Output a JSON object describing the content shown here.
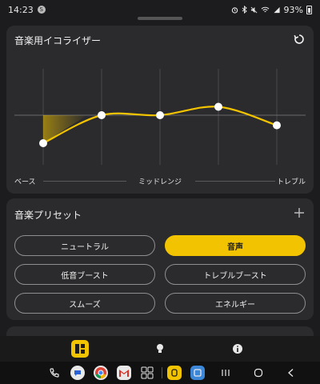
{
  "status_bar": {
    "time": "14:23",
    "notification_badge": "S",
    "battery_percent": "93%",
    "icons": [
      "alarm-icon",
      "bluetooth-icon",
      "mute-icon",
      "wifi-icon",
      "signal-icon",
      "battery-icon"
    ]
  },
  "equalizer": {
    "title": "音楽用イコライザー",
    "reset_icon": "reset-icon",
    "labels": {
      "bass": "ベース",
      "midrange": "ミッドレンジ",
      "treble": "トレブル"
    },
    "bands": [
      -0.5,
      0.0,
      0.0,
      0.15,
      -0.18
    ],
    "accent_color": "#f2c300"
  },
  "presets": {
    "title": "音楽プリセット",
    "add_icon": "plus-icon",
    "items": [
      {
        "label": "ニュートラル",
        "active": false
      },
      {
        "label": "音声",
        "active": true
      },
      {
        "label": "低音ブースト",
        "active": false
      },
      {
        "label": "トレブルブースト",
        "active": false
      },
      {
        "label": "スムーズ",
        "active": false
      },
      {
        "label": "エネルギー",
        "active": false
      }
    ]
  },
  "bottom_nav": {
    "items": [
      {
        "icon": "dashboard-icon",
        "active": true
      },
      {
        "icon": "lightbulb-icon",
        "active": false
      },
      {
        "icon": "info-icon",
        "active": false
      }
    ]
  },
  "taskbar": {
    "apps": [
      "phone-icon",
      "messages-icon",
      "chrome-icon",
      "gmail-icon",
      "app-grid-icon",
      "jabra-app-icon",
      "files-app-icon"
    ],
    "system_nav": [
      "recents-icon",
      "home-icon",
      "back-icon"
    ]
  }
}
